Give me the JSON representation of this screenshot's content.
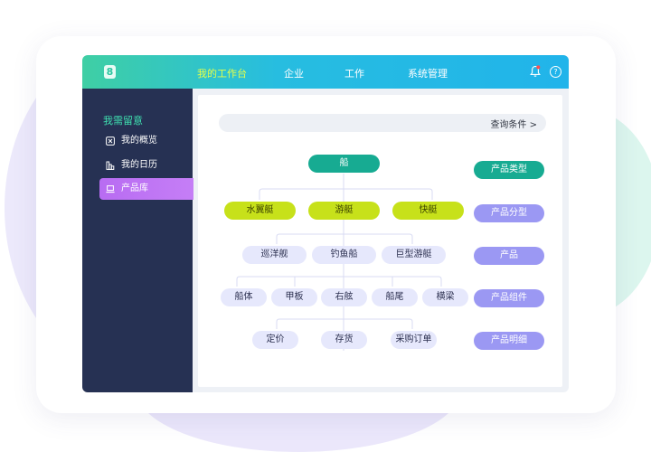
{
  "colors": {
    "topbar_gradient_start": "#3fcfa4",
    "topbar_gradient_end": "#21b4ea",
    "nav_active": "#e4ff4a",
    "sidebar_bg": "#263153",
    "sidebar_title": "#3fe0b0",
    "sidebar_active": "#c57ef6",
    "node_root": "#17ab92",
    "node_level1": "#c7e11a",
    "node_leaf": "#e6e8fc",
    "legend_purple": "#9b98f3"
  },
  "header": {
    "logo_glyph": "8",
    "nav": [
      {
        "label": "我的工作台",
        "active": true
      },
      {
        "label": "企业",
        "active": false
      },
      {
        "label": "工作",
        "active": false
      },
      {
        "label": "系统管理",
        "active": false
      }
    ],
    "notification_icon": "bell-icon",
    "help_icon": "help-icon",
    "help_glyph": "?"
  },
  "sidebar": {
    "title": "我需留意",
    "items": [
      {
        "label": "我的概览",
        "icon": "overview-icon",
        "active": false
      },
      {
        "label": "我的日历",
        "icon": "calendar-icon",
        "active": false
      },
      {
        "label": "产品库",
        "icon": "laptop-icon",
        "active": true
      }
    ]
  },
  "main": {
    "query_label": "查询条件 >",
    "tree": {
      "root": "船",
      "level1": [
        "水翼艇",
        "游艇",
        "快艇"
      ],
      "level2": [
        "巡洋舰",
        "钓鱼船",
        "巨型游艇"
      ],
      "level3": [
        "船体",
        "甲板",
        "右舷",
        "船尾",
        "横梁"
      ],
      "level4": [
        "定价",
        "存货",
        "采购订单"
      ]
    },
    "legend": [
      "产品类型",
      "产品分型",
      "产品",
      "产品组件",
      "产品明细"
    ]
  }
}
